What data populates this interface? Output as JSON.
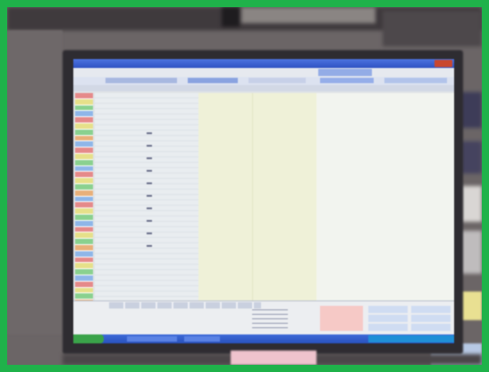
{
  "photo": {
    "colors": {
      "frame_border": "#1fb24a",
      "wall": "#6b6566",
      "monitor_bezel": "#2e2c31",
      "titlebar": "#3b5fd4",
      "sheet_left": "#e8ecee",
      "sheet_middle": "#eef0d6",
      "sheet_right": "#f1f3ee",
      "taskbar": "#2f5acb",
      "start_button": "#3aa34a",
      "pink_panel": "#f6c9c6",
      "blue_panels": "#cfdcf2"
    },
    "screen": {
      "window_title": "",
      "left_cells": [
        "#e58a8a",
        "#e6e08a",
        "#8ad18f",
        "#8fb6e8",
        "#e58a8a",
        "#e6e08a",
        "#8ad18f",
        "#e8b07a",
        "#8fb6e8",
        "#e58a8a",
        "#e6e08a",
        "#8ad18f",
        "#8fb6e8",
        "#e58a8a",
        "#e6e08a",
        "#8ad18f",
        "#e8b07a",
        "#8fb6e8",
        "#e58a8a",
        "#e6e08a",
        "#8ad18f",
        "#8fb6e8",
        "#e58a8a",
        "#e6e08a",
        "#8ad18f",
        "#e8b07a",
        "#8fb6e8",
        "#e58a8a",
        "#e6e08a",
        "#8ad18f",
        "#8fb6e8",
        "#e58a8a",
        "#e6e08a",
        "#8ad18f",
        "#e8b07a",
        "#8fb6e8",
        "#e58a8a",
        "#e6e08a",
        "#8ad18f",
        "#8fb6e8"
      ],
      "bottom_right_buttons": 6,
      "taskbar_items": 3
    },
    "objects": {
      "pink_note_text": "",
      "right_cards": 4
    }
  }
}
